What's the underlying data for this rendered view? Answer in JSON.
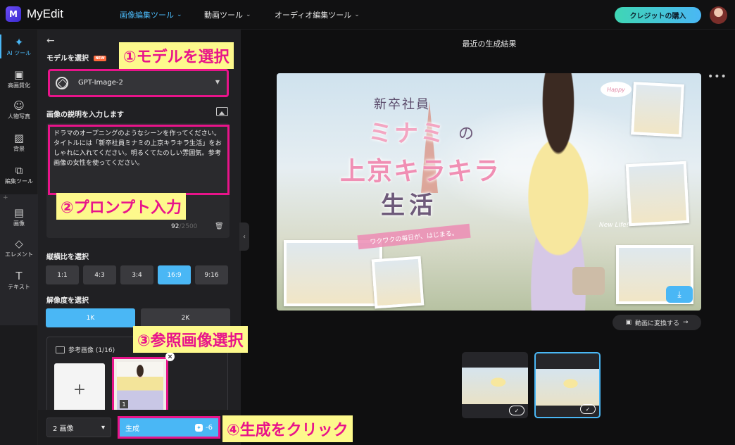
{
  "app": {
    "logo_letter": "M",
    "name": "MyEdit"
  },
  "nav": {
    "image_tools": "画像編集ツール",
    "video_tools": "動画ツール",
    "audio_tools": "オーディオ編集ツール",
    "credit_button": "クレジットの購入"
  },
  "rail": {
    "items": [
      {
        "label": "AI ツール",
        "icon": "magic-wand-icon"
      },
      {
        "label": "高画質化",
        "icon": "enhance-icon"
      },
      {
        "label": "人物写真",
        "icon": "portrait-icon"
      },
      {
        "label": "背景",
        "icon": "background-icon"
      },
      {
        "label": "編集ツール",
        "icon": "edit-tools-icon"
      },
      {
        "label": "画像",
        "icon": "image-icon"
      },
      {
        "label": "エレメント",
        "icon": "element-icon"
      },
      {
        "label": "テキスト",
        "icon": "text-icon"
      }
    ],
    "plus": "+"
  },
  "panel": {
    "model_label": "モデルを選択",
    "new_badge": "NEW",
    "model_value": "GPT-Image-2",
    "prompt_label": "画像の説明を入力します",
    "prompt_text": "ドラマのオープニングのようなシーンを作ってください。タイトルには「新卒社員ミナミの上京キラキラ生活」をおしゃれに入れてください。明るくてたのしい雰囲気。参考画像の女性を使ってください。",
    "prompt_count": "92",
    "prompt_max": "/2500",
    "ratio_label": "縦横比を選択",
    "ratios": [
      "1:1",
      "4:3",
      "3:4",
      "16:9",
      "9:16"
    ],
    "ratio_selected": "16:9",
    "resolution_label": "解像度を選択",
    "resolutions": [
      "1K",
      "2K"
    ],
    "resolution_selected": "1K",
    "reference_label": "参考画像 (1/16)",
    "reference_add": "+",
    "reference_index": "1",
    "image_count": "2 画像",
    "generate_label": "生成",
    "generate_cost": "-6"
  },
  "main": {
    "title": "最近の生成結果",
    "convert_button": "動画に変換する",
    "hero": {
      "subtitle": "新卒社員",
      "title_part1": "ミナミ",
      "title_no": "の",
      "title_part2": "上京キラキラ",
      "title_part3": "生活",
      "ribbon": "ワクワクの毎日が、はじまる。",
      "tag_happy": "Happy",
      "tag_newlife": "New Life!"
    }
  },
  "annotations": {
    "step1": "①モデルを選択",
    "step2": "②プロンプト入力",
    "step3": "③参照画像選択",
    "step4": "④生成をクリック"
  },
  "colors": {
    "accent": "#4ab7f5",
    "annotation_border": "#e8148a",
    "annotation_bg": "#fdf98c"
  }
}
